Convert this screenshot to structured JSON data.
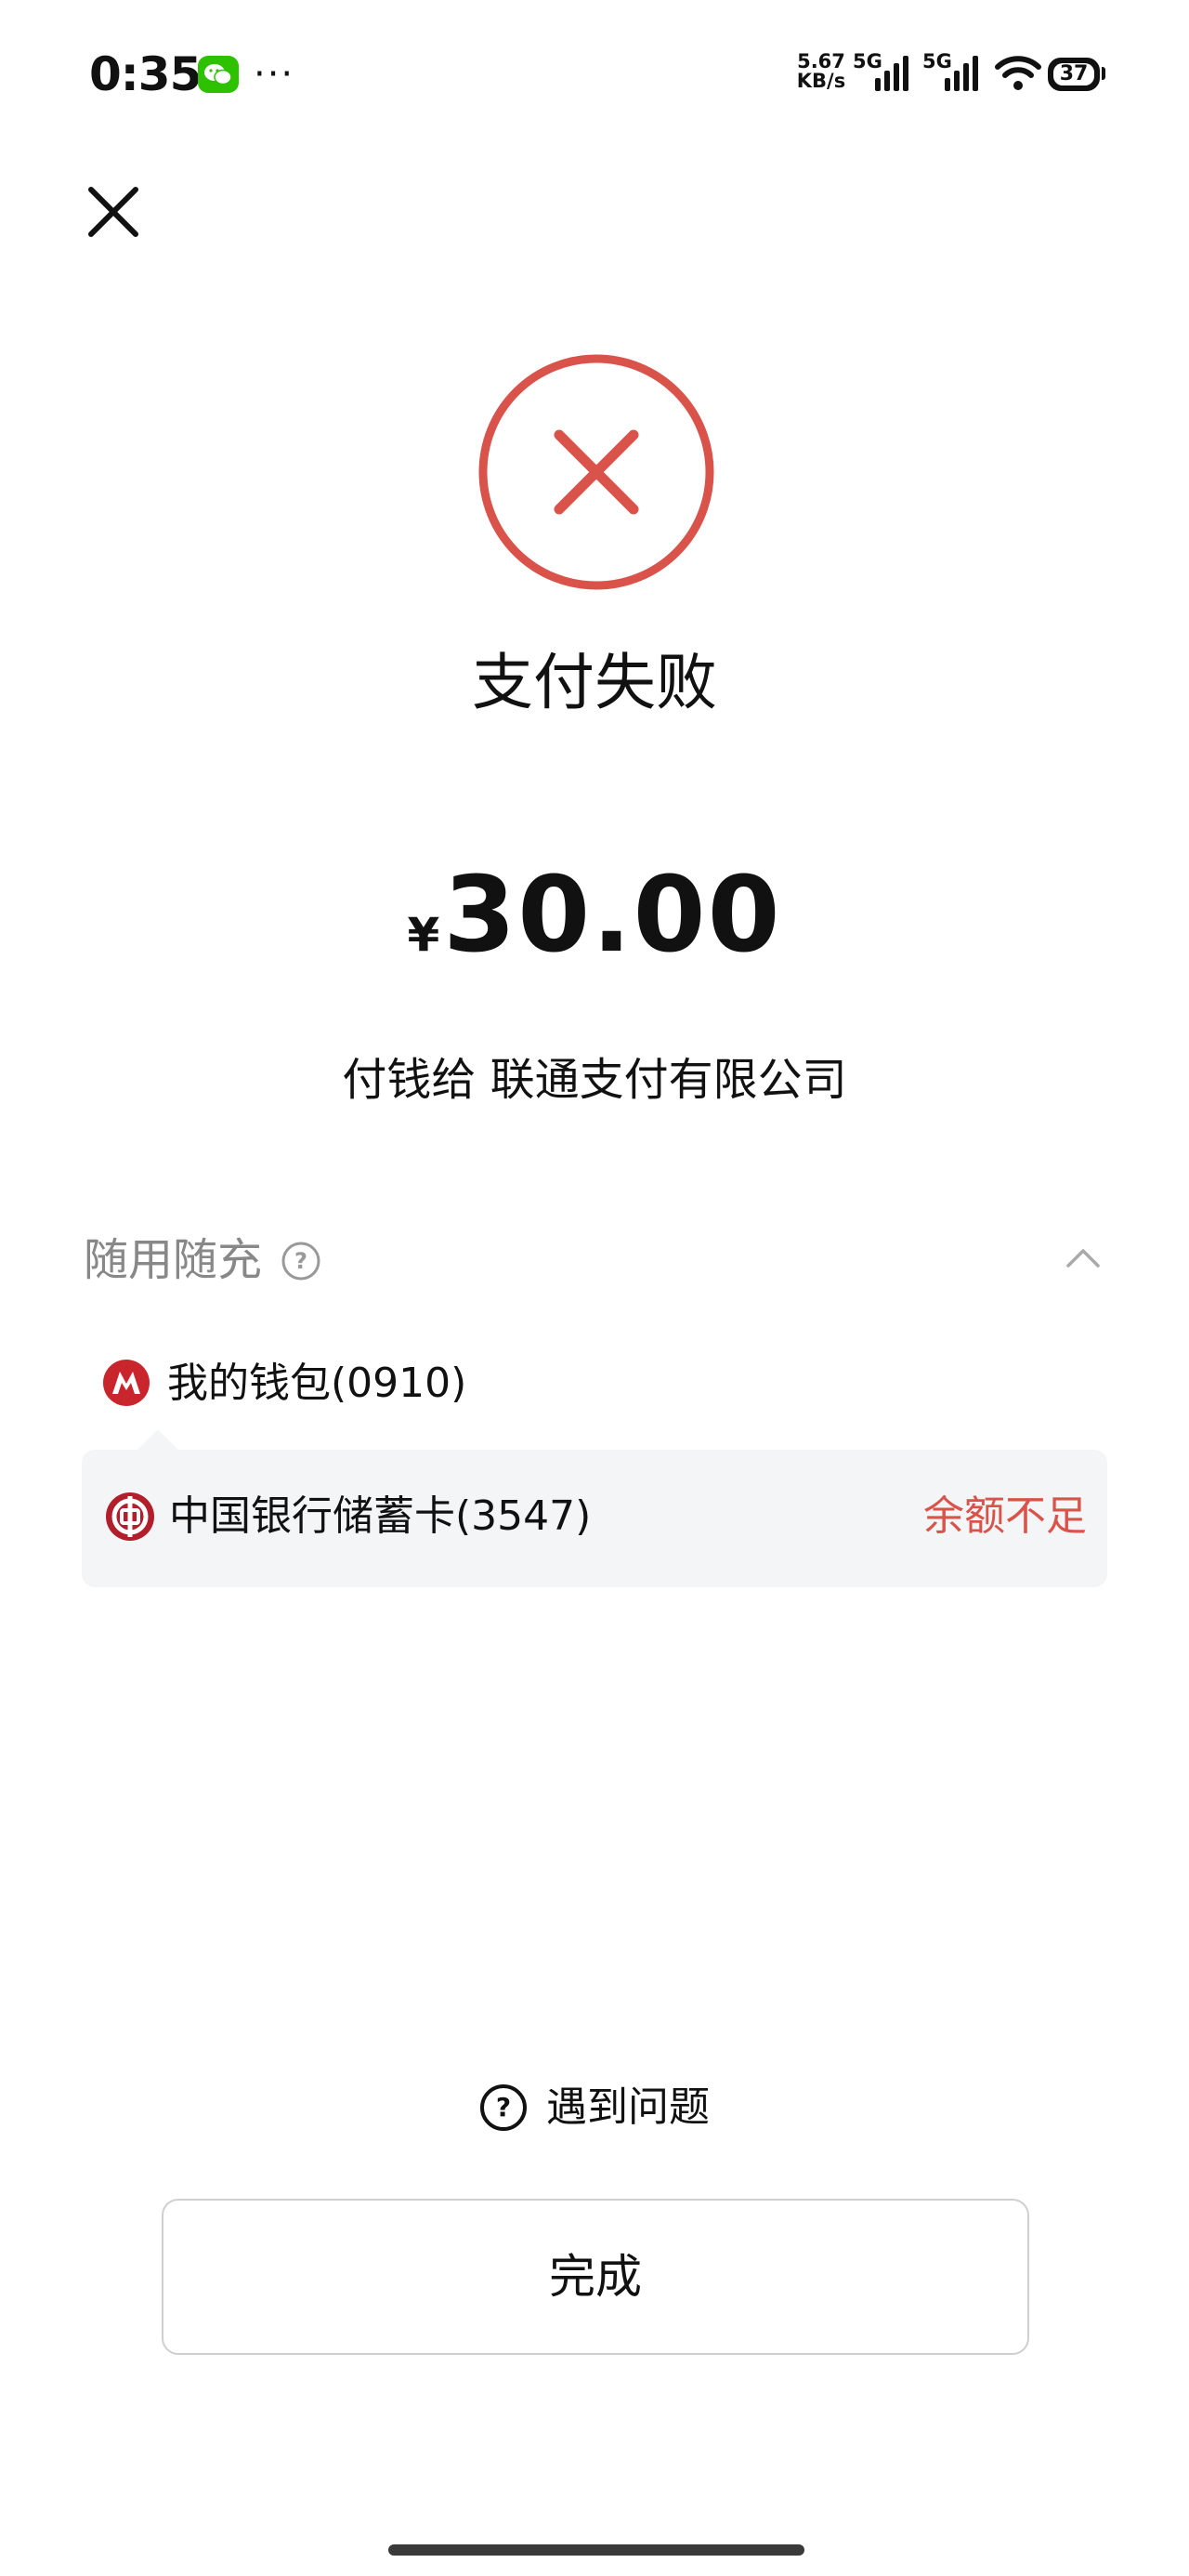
{
  "status_bar": {
    "time": "0:35",
    "app_icon": "wechat-icon",
    "more": "···",
    "net_speed_value": "5.67",
    "net_speed_unit": "KB/s",
    "sim1": "5G",
    "sim2": "5G",
    "battery": "37"
  },
  "result": {
    "title": "支付失败",
    "currency": "¥",
    "amount": "30.00",
    "payee": "付钱给 联通支付有限公司"
  },
  "payment": {
    "section_label": "随用随充",
    "methods": [
      {
        "label": "我的钱包(0910)",
        "icon": "wallet-logo-icon"
      },
      {
        "label": "中国银行储蓄卡(3547)",
        "icon": "bank-of-china-icon",
        "status": "余额不足"
      }
    ]
  },
  "footer": {
    "help_label": "遇到问题",
    "done_label": "完成"
  },
  "colors": {
    "fail_red": "#d9534a",
    "card_bg": "#f4f5f7",
    "wechat_green": "#2dc100"
  }
}
